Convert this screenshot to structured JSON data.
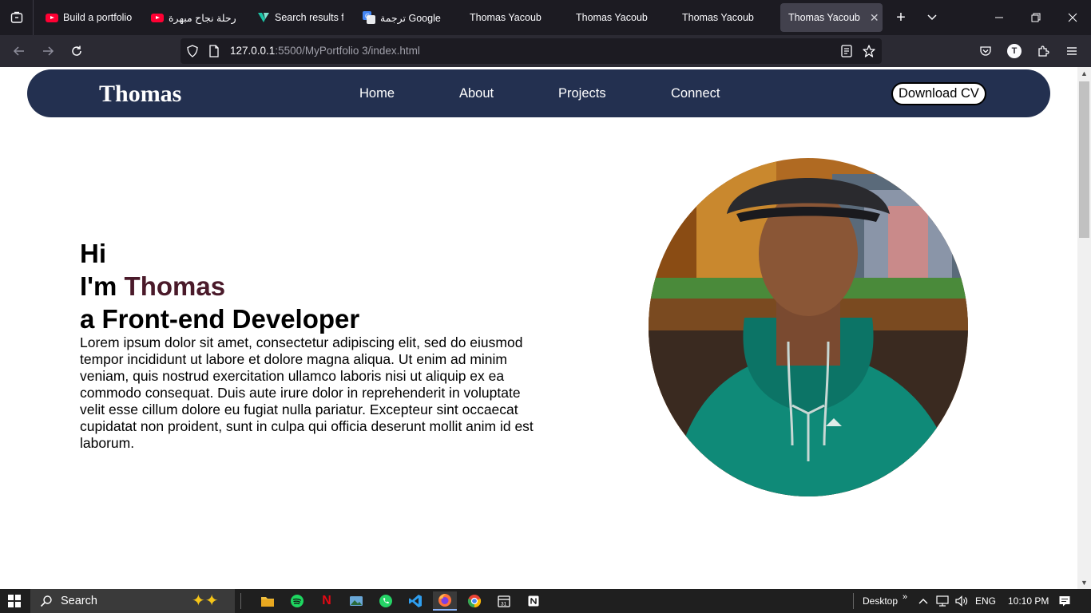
{
  "browser": {
    "tabs": [
      {
        "title": "Build a portfolio",
        "icon": "youtube-icon"
      },
      {
        "title": "رحلة نجاح مبهرة",
        "icon": "youtube-icon"
      },
      {
        "title": "Search results fo",
        "icon": "vuetify-icon"
      },
      {
        "title": "ترجمة Google",
        "icon": "google-translate-icon"
      },
      {
        "title": "Thomas Yacoub",
        "icon": ""
      },
      {
        "title": "Thomas Yacoub",
        "icon": ""
      },
      {
        "title": "Thomas Yacoub",
        "icon": ""
      },
      {
        "title": "Thomas Yacoub",
        "icon": "",
        "active": true
      }
    ],
    "url_host": "127.0.0.1",
    "url_rest": ":5500/MyPortfolio 3/index.html",
    "profile_initial": "T"
  },
  "site": {
    "brand": "Thomas",
    "nav": [
      "Home",
      "About",
      "Projects",
      "Connect"
    ],
    "cv_button": "Download CV",
    "hero": {
      "line1": "Hi",
      "line2_prefix": "I'm ",
      "line2_name": "Thomas",
      "line3": "a Front-end Developer",
      "paragraph": "Lorem ipsum dolor sit amet, consectetur adipiscing elit, sed do eiusmod tempor incididunt ut labore et dolore magna aliqua. Ut enim ad minim veniam, quis nostrud exercitation ullamco laboris nisi ut aliquip ex ea commodo consequat. Duis aute irure dolor in reprehenderit in voluptate velit esse cillum dolore eu fugiat nulla pariatur. Excepteur sint occaecat cupidatat non proident, sunt in culpa qui officia deserunt mollit anim id est laborum."
    },
    "colors": {
      "header_bg": "#233050",
      "accent_name": "#4a1a2a"
    }
  },
  "taskbar": {
    "search_label": "Search",
    "desktop_label": "Desktop",
    "language": "ENG",
    "time": "10:10 PM",
    "apps": [
      "file-explorer-icon",
      "spotify-icon",
      "netflix-icon",
      "photos-icon",
      "whatsapp-icon",
      "vscode-icon",
      "firefox-icon",
      "chrome-icon",
      "calendar-icon",
      "notion-icon"
    ]
  }
}
